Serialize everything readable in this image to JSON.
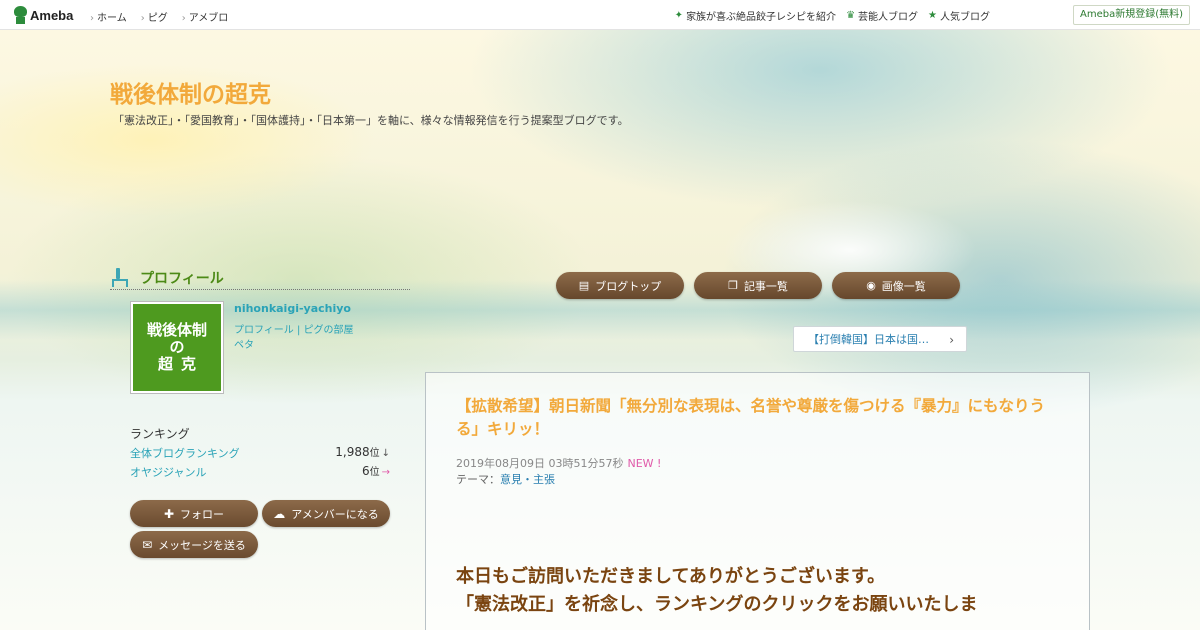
{
  "topbar": {
    "logo": "Ameba",
    "nav": [
      "ホーム",
      "ピグ",
      "アメブロ"
    ],
    "right": [
      {
        "icon": "sparkle-icon",
        "label": "家族が喜ぶ絶品餃子レシピを紹介"
      },
      {
        "icon": "crown-icon",
        "label": "芸能人ブログ"
      },
      {
        "icon": "star-icon",
        "label": "人気ブログ"
      }
    ],
    "signup": "Ameba新規登録(無料)"
  },
  "blog": {
    "title": "戦後体制の超克",
    "description": "「憲法改正」・「愛国教育」・「国体護持」・「日本第一」を軸に、様々な情報発信を行う提案型ブログです。"
  },
  "profile": {
    "heading": "プロフィール",
    "avatar_lines": [
      "戦後体制",
      "の",
      "超克"
    ],
    "name": "nihonkaigi-yachiyo",
    "link": "プロフィール | ピグの部屋",
    "extra": "ペタ"
  },
  "ranking": {
    "title": "ランキング",
    "rows": [
      {
        "name": "全体ブログランキング",
        "value": "1,988",
        "unit": "位",
        "arrow": "↓"
      },
      {
        "name": "オヤジジャンル",
        "value": "6",
        "unit": "位",
        "arrow": "→"
      }
    ]
  },
  "actions": {
    "follow": "フォロー",
    "member": "アメンバーになる",
    "message": "メッセージを送る"
  },
  "nav_buttons": {
    "top": "ブログトップ",
    "list": "記事一覧",
    "images": "画像一覧"
  },
  "prev_entry": "【打倒韓国】日本は国…",
  "article": {
    "title": "【拡散希望】朝日新聞「無分別な表現は、名誉や尊厳を傷つける『暴力』にもなりうる」キリッ！",
    "date": "2019年08月09日 03時51分57秒",
    "new_badge": "NEW !",
    "theme_label": "テーマ：",
    "theme": "意見・主張",
    "body_line1": "本日もご訪問いただきましてありがとうございます。",
    "body_line2": "「憲法改正」を祈念し、ランキングのクリックをお願いいたしま"
  },
  "colors": {
    "title": "#f2a93b",
    "link": "#2aa3b7",
    "button": "#7a5a3c",
    "body_text": "#7a4410",
    "new_badge": "#e05aa9"
  }
}
